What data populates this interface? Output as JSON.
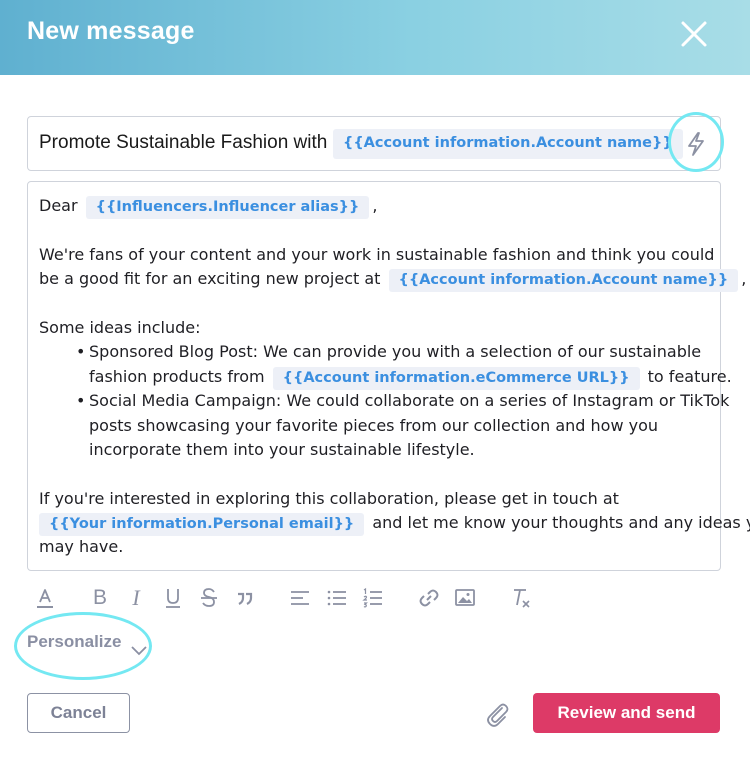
{
  "header": {
    "title": "New message",
    "close_icon": "close-icon"
  },
  "subject": {
    "text": "Promote Sustainable Fashion with",
    "chip": "{{Account information.Account name}}",
    "action_icon": "lightning-bolt-icon"
  },
  "body": {
    "greeting": "Dear",
    "greeting_chip": "{{Influencers.Influencer alias}}",
    "greeting_end": ",",
    "p1_line1": "We're fans of your content and your work in sustainable fashion and think you could",
    "p1_line2": "be a good fit for an exciting new project at",
    "p1_chip": "{{Account information.Account name}}",
    "p1_end": ",",
    "ideas_intro": "Some  ideas include:",
    "bullet1_line1": "Sponsored Blog Post: We can provide you with a selection of our sustainable",
    "bullet1_line2": "fashion products from",
    "bullet1_chip": "{{Account information.eCommerce URL}}",
    "bullet1_end": "to feature.",
    "bullet2_line1": "Social Media Campaign: We could collaborate on a series of Instagram or TikTok",
    "bullet2_line2": "posts showcasing your favorite pieces from our collection and how you",
    "bullet2_line3": "incorporate them into your sustainable lifestyle.",
    "closing_line1": "If you're interested in exploring this collaboration, please get in touch at",
    "closing_chip": "{{Your information.Personal email}}",
    "closing_line2": "and let me know your thoughts and any ideas you",
    "closing_line3": "may have."
  },
  "toolbar": {
    "icons": [
      "text-color-icon",
      "bold-icon",
      "italic-icon",
      "underline-icon",
      "strikethrough-icon",
      "quote-icon",
      "align-icon",
      "bullet-list-icon",
      "numbered-list-icon",
      "link-icon",
      "image-icon",
      "clear-format-icon"
    ],
    "bold_glyph": "B",
    "italic_glyph": "I"
  },
  "personalize": {
    "label": "Personalize"
  },
  "footer": {
    "cancel_label": "Cancel",
    "attach_icon": "paperclip-icon",
    "send_label": "Review and send"
  },
  "colors": {
    "header_gradient_start": "#5fb0d0",
    "header_gradient_end": "#a8dde7",
    "chip_bg": "#edf0f7",
    "chip_text": "#3b8fe0",
    "send_button": "#dd3a67",
    "highlight_ring": "#74e8f2",
    "muted_text": "#8a8fa3"
  }
}
